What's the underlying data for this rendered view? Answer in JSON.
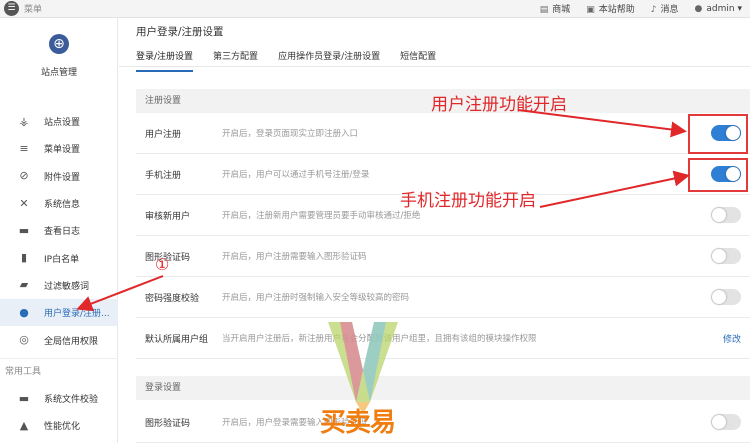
{
  "topbar": {
    "menu_label": "菜单",
    "items": [
      {
        "icon": "shop-icon",
        "label": "商城"
      },
      {
        "icon": "help-icon",
        "label": "本站帮助"
      },
      {
        "icon": "bell-icon",
        "label": "消息"
      },
      {
        "icon": "user-icon",
        "label": "admin"
      }
    ]
  },
  "sidebar": {
    "site_mgmt_label": "站点管理",
    "items": [
      {
        "label": "站点设置",
        "icon": "sitemap-icon"
      },
      {
        "label": "菜单设置",
        "icon": "list-icon"
      },
      {
        "label": "附件设置",
        "icon": "paperclip-icon"
      },
      {
        "label": "系统信息",
        "icon": "tools-icon"
      },
      {
        "label": "查看日志",
        "icon": "log-icon"
      },
      {
        "label": "IP白名单",
        "icon": "ip-icon"
      },
      {
        "label": "过滤敏感词",
        "icon": "filter-icon"
      },
      {
        "label": "用户登录/注册...",
        "icon": "user-icon"
      },
      {
        "label": "全局信用权限",
        "icon": "credit-icon"
      }
    ],
    "tools_header": "常用工具",
    "tools": [
      {
        "label": "系统文件校验",
        "icon": "folder-icon"
      },
      {
        "label": "性能优化",
        "icon": "rocket-icon"
      }
    ]
  },
  "main": {
    "title": "用户登录/注册设置",
    "tabs": [
      "登录/注册设置",
      "第三方配置",
      "应用操作员登录/注册设置",
      "短信配置"
    ],
    "register_header": "注册设置",
    "register_rows": [
      {
        "name": "用户注册",
        "desc": "开启后，登录页面现实立即注册入口",
        "on": true
      },
      {
        "name": "手机注册",
        "desc": "开启后，用户可以通过手机号注册/登录",
        "on": true
      },
      {
        "name": "审核新用户",
        "desc": "开启后，注册新用户需要管理员要手动审核通过/拒绝",
        "on": false
      },
      {
        "name": "图形验证码",
        "desc": "开启后，用户注册需要输入图形验证码",
        "on": false
      },
      {
        "name": "密码强度校验",
        "desc": "开启后，用户注册时强制输入安全等级较高的密码",
        "on": false
      },
      {
        "name": "默认所属用户组",
        "desc": "当开启用户注册后，新注册用户将会分配到该用户组里，且拥有该组的模块操作权限",
        "action": "修改"
      }
    ],
    "login_header": "登录设置",
    "login_rows": [
      {
        "name": "图形验证码",
        "desc": "开启后，用户登录需要输入图形验证码",
        "on": false
      }
    ]
  },
  "annotations": {
    "register_note": "用户注册功能开启",
    "mobile_note": "手机注册功能开启",
    "marker": "①"
  },
  "watermark": {
    "text": "买卖易",
    "letter": "V"
  },
  "colors": {
    "accent": "#2f7fd4",
    "annotation": "#e0282a"
  }
}
